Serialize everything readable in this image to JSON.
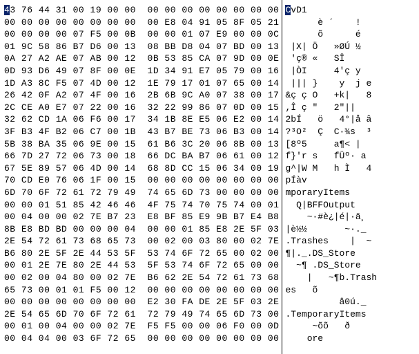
{
  "hex_rows": [
    "43 76 44 31 00 19 00 00  00 00 00 00 00 00 00 00",
    "00 00 00 00 00 00 00 00  00 E8 04 91 05 8F 05 21",
    "00 00 00 00 07 F5 00 0B  00 00 01 07 E9 00 00 0C",
    "01 9C 58 86 B7 D6 00 13  08 BB D8 04 07 BD 00 13",
    "0A 27 A2 AE 07 AB 00 12  0B 53 85 CA 07 9D 00 0E",
    "0D 93 D6 49 07 8F 00 0E  1D 34 91 E7 05 79 00 16",
    "1D A3 8C F5 07 4D 00 12  1E 79 17 01 07 65 00 14",
    "26 42 0F A2 07 4F 00 16  2B 6B 9C A0 07 38 00 17",
    "2C CE A0 E7 07 22 00 16  32 22 99 86 07 0D 00 15",
    "32 62 CD 1A 06 F6 00 17  34 1B 8E E5 06 E2 00 14",
    "3F B3 4F B2 06 C7 00 1B  43 B7 BE 73 06 B3 00 14",
    "5B 38 BA 35 06 9E 00 15  61 B6 3C 20 06 8B 00 13",
    "66 7D 27 72 06 73 00 18  66 DC BA B7 06 61 00 12",
    "67 5E 89 57 06 4D 00 14  68 8D CC 15 06 34 00 19",
    "70 CD E0 76 06 1F 00 15  00 00 00 00 00 00 00 00",
    "6D 70 6F 72 61 72 79 49  74 65 6D 73 00 00 00 00",
    "00 00 01 51 85 42 46 46  4F 75 74 70 75 74 00 01",
    "00 04 00 00 02 7E B7 23  E8 BF 85 E9 9B B7 E4 B8",
    "8B E8 BD BD 00 00 00 04  00 00 01 85 E8 2E 5F 03",
    "2E 54 72 61 73 68 65 73  00 02 00 03 80 00 02 7E",
    "B6 80 2E 5F 2E 44 53 5F  53 74 6F 72 65 00 02 00",
    "00 01 2E 7E 80 2E 44 53  5F 53 74 6F 72 65 00 00",
    "00 02 00 04 80 00 02 7E  B6 62 2E 54 72 61 73 68",
    "65 73 00 01 01 F5 00 12  00 00 00 00 00 00 00 00",
    "00 00 00 00 00 00 00 00  E2 30 FA DE 2E 5F 03 2E",
    "2E 54 65 6D 70 6F 72 61  72 79 49 74 65 6D 73 00",
    "00 01 00 04 00 00 02 7E  F5 F5 00 00 06 F0 00 0D",
    "00 04 04 00 03 6F 72 65  00 00 00 00 00 00 00 00"
  ],
  "ascii_rows": [
    "CvD1            ",
    "      è ´    !",
    "      õ      é  ",
    " |X| Ö   »ØÚ ½  ",
    " 'ç® «   SÎ    ",
    " |ÒI     4'ç y  ",
    " ||| }    y  j e",
    "&ç ç O   +k|   8",
    ",Î ç \"   2\"||   ",
    "2bÍ   ö   4°|å â",
    "?³O²  Ç  C·¾s  ³",
    "[8º5     a¶< |  ",
    "f}'r s   fÜº· a ",
    "g^|W M   h Ì   4",
    "pÍàv            ",
    "mporaryItems    ",
    "  Q|BFFOutput   ",
    "    ~·#è¿|é|·ä¸  ",
    "|è½½       ~·._ ",
    ".Trashes    |  ~",
    "¶|._.DS_Store   ",
    "  ~¶ .DS_Store  ",
    "    |   ~¶b.Trash",
    "es   õ          ",
    "          â0ú._ ",
    ".TemporaryItems ",
    "     ~õõ   ð   ",
    "    ore         "
  ],
  "selection": {
    "row": 0,
    "col": 0
  }
}
